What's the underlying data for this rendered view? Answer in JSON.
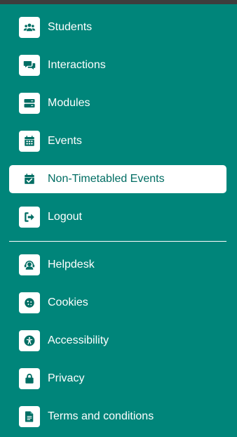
{
  "menu": {
    "primary": [
      {
        "label": "Students",
        "icon": "users-icon"
      },
      {
        "label": "Interactions",
        "icon": "chat-bubbles-icon"
      },
      {
        "label": "Modules",
        "icon": "server-icon"
      },
      {
        "label": "Events",
        "icon": "calendar-icon"
      },
      {
        "label": "Non-Timetabled Events",
        "icon": "calendar-check-icon",
        "active": true
      },
      {
        "label": "Logout",
        "icon": "logout-icon"
      }
    ],
    "secondary": [
      {
        "label": "Helpdesk",
        "icon": "headset-icon"
      },
      {
        "label": "Cookies",
        "icon": "cookie-icon"
      },
      {
        "label": "Accessibility",
        "icon": "accessibility-icon"
      },
      {
        "label": "Privacy",
        "icon": "lock-icon"
      },
      {
        "label": "Terms and conditions",
        "icon": "document-icon"
      }
    ]
  },
  "colors": {
    "background": "#00857a",
    "active_bg": "#ffffff",
    "active_text": "#006d63",
    "icon_fg": "#006d63",
    "text": "#ffffff"
  }
}
